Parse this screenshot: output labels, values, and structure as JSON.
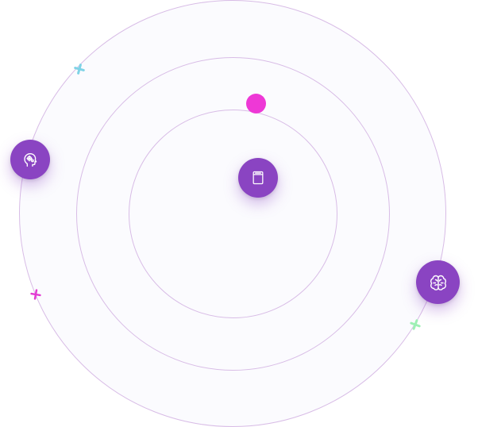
{
  "colors": {
    "ring_stroke": "#d8bce6",
    "ring_fill": "#fbfbfe",
    "badge": "#8a44c2",
    "dot": "#ee38d6",
    "spark_cyan": "#7fd3e6",
    "spark_pink": "#e23ad2",
    "spark_green": "#9ef0b4"
  },
  "orbits": {
    "count": 3,
    "badges": [
      {
        "icon": "head-with-gears-icon"
      },
      {
        "icon": "book-icon"
      },
      {
        "icon": "brain-icon"
      }
    ],
    "decorations": [
      {
        "icon": "plus-sparkle-icon",
        "color": "cyan"
      },
      {
        "icon": "plus-sparkle-icon",
        "color": "pink"
      },
      {
        "icon": "plus-sparkle-icon",
        "color": "green"
      }
    ]
  }
}
